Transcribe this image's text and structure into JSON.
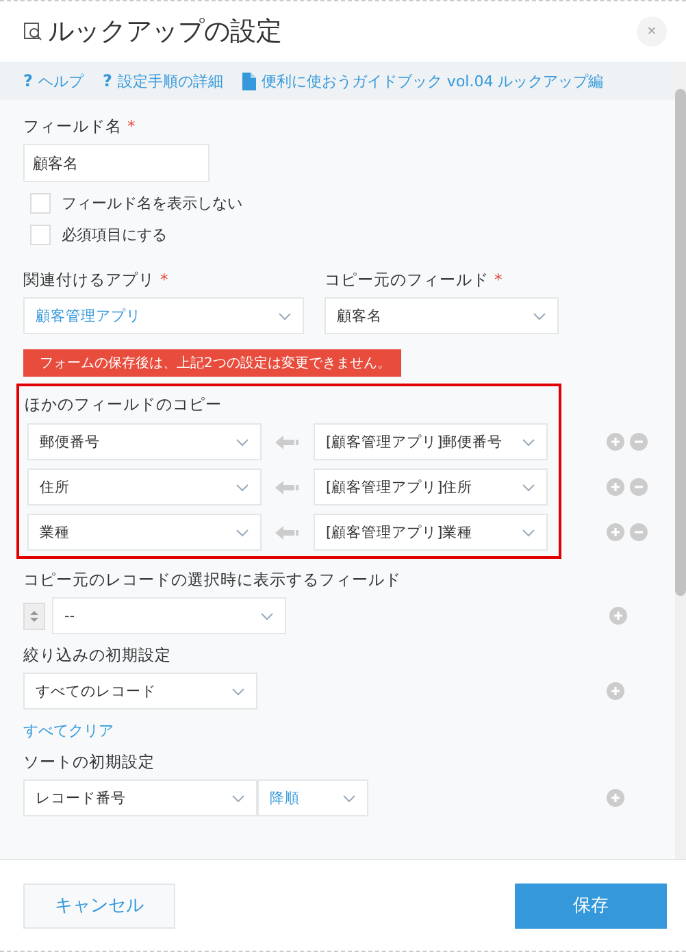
{
  "dialog": {
    "title": "ルックアップの設定",
    "close": "×"
  },
  "links": [
    {
      "kind": "help",
      "mark": "?",
      "label": "ヘルプ"
    },
    {
      "kind": "help",
      "mark": "?",
      "label": "設定手順の詳細"
    },
    {
      "kind": "doc",
      "label": "便利に使おうガイドブック vol.04 ルックアップ編"
    }
  ],
  "field_name": {
    "label": "フィールド名",
    "required_mark": "*",
    "value": "顧客名"
  },
  "checkboxes": [
    {
      "label": "フィールド名を表示しない",
      "checked": false
    },
    {
      "label": "必須項目にする",
      "checked": false
    }
  ],
  "related_app": {
    "label": "関連付けるアプリ",
    "required_mark": "*",
    "value": "顧客管理アプリ"
  },
  "source_field": {
    "label": "コピー元のフィールド",
    "required_mark": "*",
    "value": "顧客名"
  },
  "warning": "フォームの保存後は、上記2つの設定は変更できません。",
  "copy_fields": {
    "title": "ほかのフィールドのコピー",
    "highlighted": true,
    "rows": [
      {
        "target": "郵便番号",
        "source": "[顧客管理アプリ]郵便番号"
      },
      {
        "target": "住所",
        "source": "[顧客管理アプリ]住所"
      },
      {
        "target": "業種",
        "source": "[顧客管理アプリ]業種"
      }
    ]
  },
  "display_fields": {
    "label": "コピー元のレコードの選択時に表示するフィールド",
    "rows": [
      {
        "value": "--"
      }
    ]
  },
  "filter": {
    "label": "絞り込みの初期設定",
    "value": "すべてのレコード",
    "clear_link": "すべてクリア"
  },
  "sort": {
    "label": "ソートの初期設定",
    "field": "レコード番号",
    "order": "降順"
  },
  "buttons": [
    {
      "kind": "cancel",
      "label": "キャンセル"
    },
    {
      "kind": "save",
      "label": "保存"
    }
  ]
}
